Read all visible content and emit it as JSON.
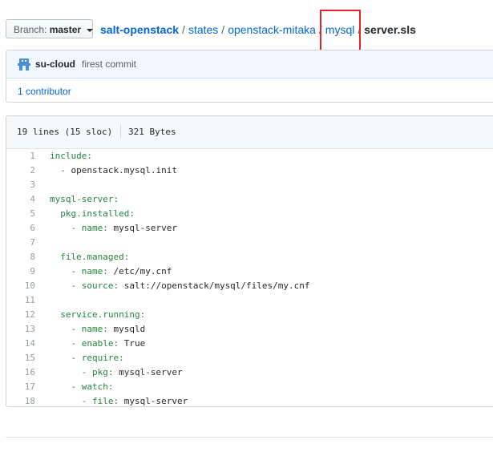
{
  "branch": {
    "label": "Branch:",
    "value": "master"
  },
  "breadcrumb": {
    "root": "salt-openstack",
    "parts": [
      "states",
      "openstack-mitaka",
      "mysql"
    ],
    "separator": "/",
    "file": "server.sls"
  },
  "commit": {
    "author": "su-cloud",
    "message": "firest commit"
  },
  "contributors": "1 contributor",
  "file_info": {
    "lines": "19 lines (15 sloc)",
    "size": "321 Bytes"
  },
  "code_lines": [
    {
      "n": "1",
      "indent": "",
      "key": "include:",
      "val": ""
    },
    {
      "n": "2",
      "indent": "  ",
      "key": "- ",
      "val": "openstack.mysql.init"
    },
    {
      "n": "3",
      "indent": "",
      "key": "",
      "val": ""
    },
    {
      "n": "4",
      "indent": "",
      "key": "mysql-server:",
      "val": ""
    },
    {
      "n": "5",
      "indent": "  ",
      "key": "pkg.installed:",
      "val": ""
    },
    {
      "n": "6",
      "indent": "    ",
      "key": "- name: ",
      "val": "mysql-server"
    },
    {
      "n": "7",
      "indent": "",
      "key": "",
      "val": ""
    },
    {
      "n": "8",
      "indent": "  ",
      "key": "file.managed:",
      "val": ""
    },
    {
      "n": "9",
      "indent": "    ",
      "key": "- name: ",
      "val": "/etc/my.cnf"
    },
    {
      "n": "10",
      "indent": "    ",
      "key": "- source: ",
      "val": "salt://openstack/mysql/files/my.cnf"
    },
    {
      "n": "11",
      "indent": "",
      "key": "",
      "val": ""
    },
    {
      "n": "12",
      "indent": "  ",
      "key": "service.running:",
      "val": ""
    },
    {
      "n": "13",
      "indent": "    ",
      "key": "- name: ",
      "val": "mysqld"
    },
    {
      "n": "14",
      "indent": "    ",
      "key": "- enable: ",
      "val": "True"
    },
    {
      "n": "15",
      "indent": "    ",
      "key": "- require:",
      "val": ""
    },
    {
      "n": "16",
      "indent": "      ",
      "key": "- pkg: ",
      "val": "mysql-server"
    },
    {
      "n": "17",
      "indent": "    ",
      "key": "- watch:",
      "val": ""
    },
    {
      "n": "18",
      "indent": "      ",
      "key": "- file: ",
      "val": "mysql-server"
    }
  ],
  "colors": {
    "link": "#0366d6",
    "yaml_key": "#22863a",
    "highlight_box": "#e8222a"
  }
}
